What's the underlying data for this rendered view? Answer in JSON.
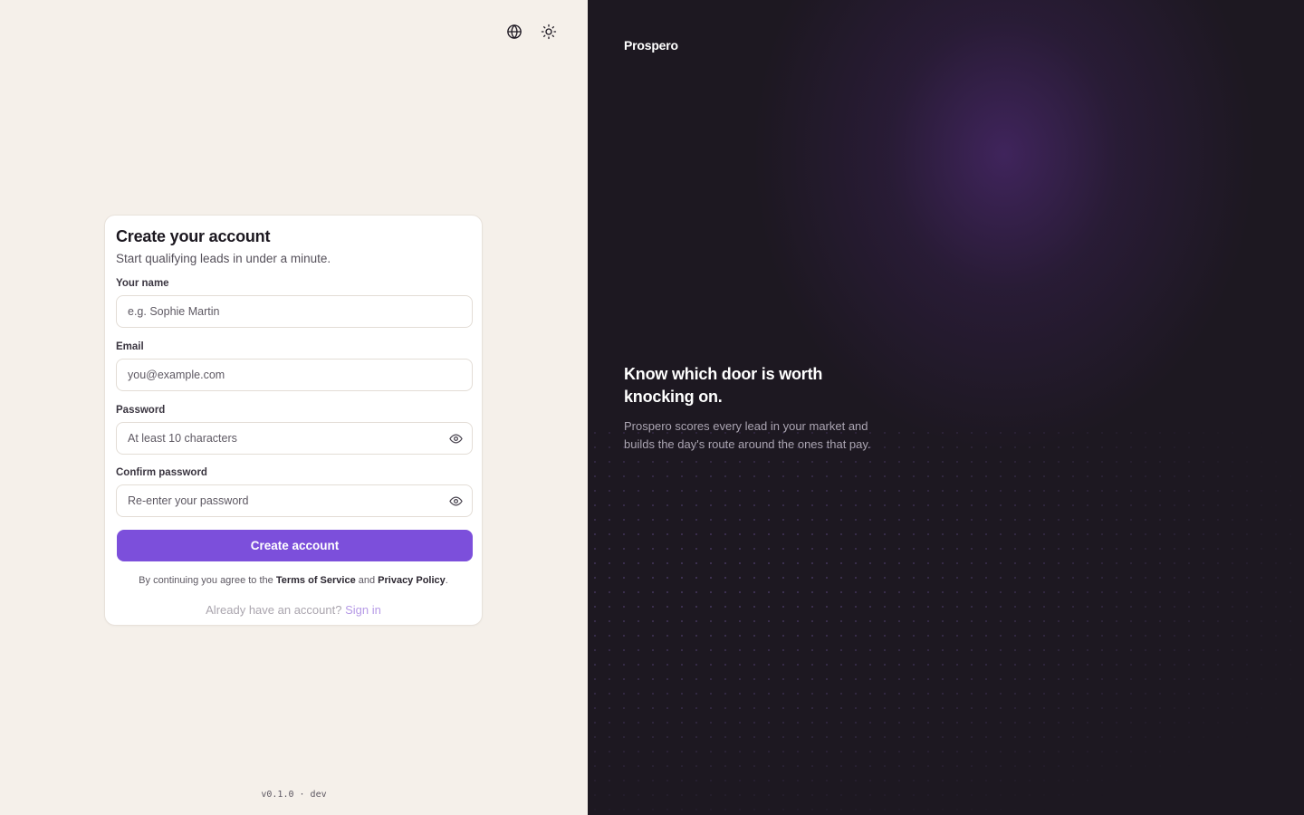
{
  "header": {
    "language_icon": "globe-icon",
    "theme_icon": "sun-icon"
  },
  "signup": {
    "title": "Create your account",
    "subtitle": "Start qualifying leads in under a minute.",
    "name_label": "Your name",
    "name_placeholder": "e.g. Sophie Martin",
    "email_label": "Email",
    "email_placeholder": "you@example.com",
    "password_label": "Password",
    "password_placeholder": "At least 10 characters",
    "confirm_label": "Confirm password",
    "confirm_placeholder": "Re-enter your password",
    "submit_label": "Create account",
    "terms_prefix": "By continuing you agree to the ",
    "terms_link": "Terms of Service",
    "terms_and": " and ",
    "privacy_link": "Privacy Policy",
    "terms_suffix": ".",
    "have_account": "Already have an account?",
    "signin_link": "Sign in"
  },
  "footer": {
    "version": "v0.1.0 · dev"
  },
  "promo": {
    "brand": "Prospero",
    "headline": "Know which door is worth knocking on.",
    "body": "Prospero scores every lead in your market and builds the day's route around the ones that pay."
  },
  "colors": {
    "accent": "#7c4fdb",
    "link": "#b69ae6",
    "left_background": "#f5f0ea",
    "right_background": "#1d1821"
  }
}
